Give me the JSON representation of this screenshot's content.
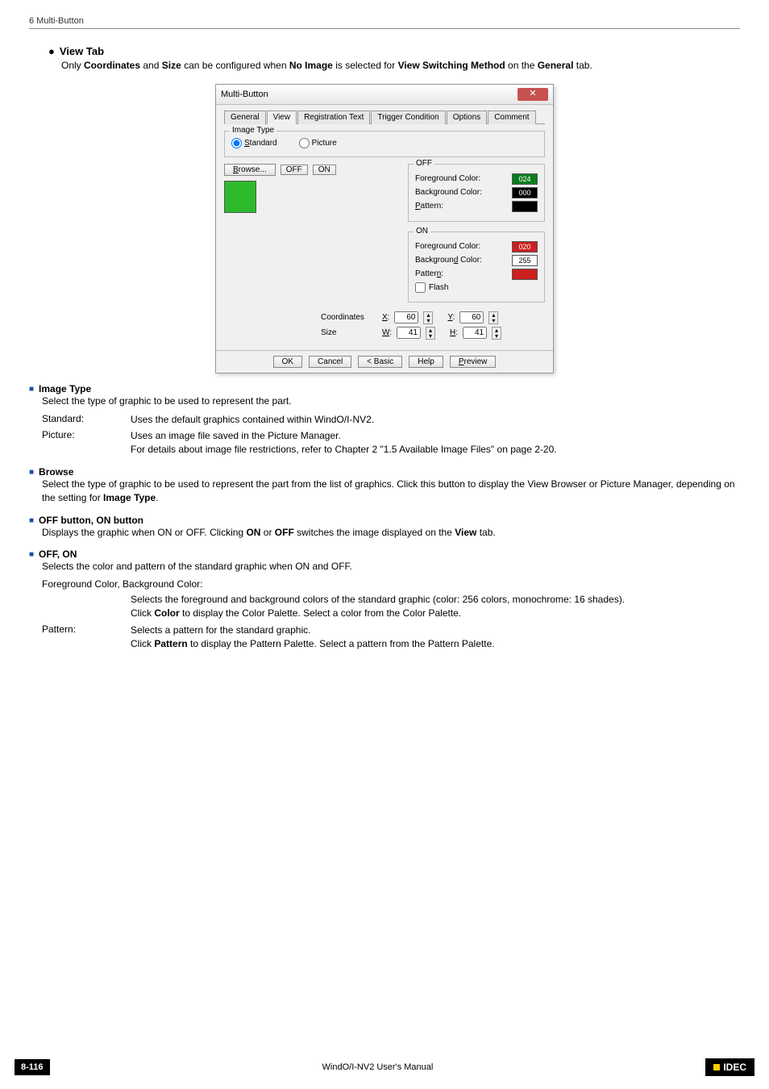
{
  "header": {
    "title": "6 Multi-Button"
  },
  "view_section": {
    "bullet": "●",
    "title_prefix": "View",
    "title_suffix": " Tab",
    "desc_parts": [
      "Only ",
      "Coordinates",
      " and ",
      "Size",
      " can be configured when ",
      "No Image",
      " is selected for ",
      "View Switching Method",
      " on the ",
      "General",
      " tab."
    ]
  },
  "dialog": {
    "title": "Multi-Button",
    "close": "✕",
    "tabs": [
      "General",
      "View",
      "Registration Text",
      "Trigger Condition",
      "Options",
      "Comment"
    ],
    "image_type": {
      "legend": "Image Type",
      "standard": "Standard",
      "picture": "Picture"
    },
    "browse": "Browse...",
    "off_btn": "OFF",
    "on_btn": "ON",
    "off_group": {
      "legend": "OFF",
      "fg": "Foreground Color:",
      "fg_val": "024",
      "bg": "Background Color:",
      "bg_val": "000",
      "pattern": "Pattern:"
    },
    "on_group": {
      "legend": "ON",
      "fg": "Foreground Color:",
      "fg_val": "020",
      "bg": "Background Color:",
      "bg_val": "255",
      "pattern": "Pattern:",
      "flash": "Flash"
    },
    "coords": {
      "label": "Coordinates",
      "x_lbl": "X:",
      "x": "60",
      "y_lbl": "Y:",
      "y": "60"
    },
    "size": {
      "label": "Size",
      "w_lbl": "W:",
      "w": "41",
      "h_lbl": "H:",
      "h": "41"
    },
    "buttons": {
      "ok": "OK",
      "cancel": "Cancel",
      "basic": "< Basic",
      "help": "Help",
      "preview": "Preview"
    }
  },
  "subs": {
    "image_type": {
      "title": "Image Type",
      "desc": "Select the type of graphic to be used to represent the part.",
      "rows": [
        {
          "k": "Standard:",
          "v": "Uses the default graphics contained within WindO/I-NV2."
        },
        {
          "k": "Picture:",
          "v": "Uses an image file saved in the Picture Manager.",
          "v2": "For details about image file restrictions, refer to Chapter 2 \"1.5 Available Image Files\" on page 2-20."
        }
      ]
    },
    "browse": {
      "title": "Browse",
      "desc_parts": [
        "Select the type of graphic to be used to represent the part from the list of graphics. Click this button to display the View Browser or Picture Manager, depending on the setting for ",
        "Image Type",
        "."
      ]
    },
    "off_on_btn": {
      "title": "OFF button, ON button",
      "desc_parts": [
        "Displays the graphic when ON or OFF. Clicking ",
        "ON",
        " or ",
        "OFF",
        " switches the image displayed on the ",
        "View",
        " tab."
      ]
    },
    "off_on": {
      "title": "OFF, ON",
      "desc": "Selects the color and pattern of the standard graphic when ON and OFF.",
      "fgbg_label": "Foreground Color, Background Color:",
      "fgbg_val1": "Selects the foreground and background colors of the standard graphic (color: 256 colors, monochrome: 16 shades).",
      "fgbg_val2_parts": [
        "Click ",
        "Color",
        " to display the Color Palette. Select a color from the Color Palette."
      ],
      "pattern_k": "Pattern:",
      "pattern_v1": "Selects a pattern for the standard graphic.",
      "pattern_v2_parts": [
        "Click ",
        "Pattern",
        " to display the Pattern Palette. Select a pattern from the Pattern Palette."
      ]
    }
  },
  "footer": {
    "page": "8-116",
    "center": "WindO/I-NV2 User's Manual",
    "brand": "IDEC"
  },
  "bullet_sq": "■"
}
